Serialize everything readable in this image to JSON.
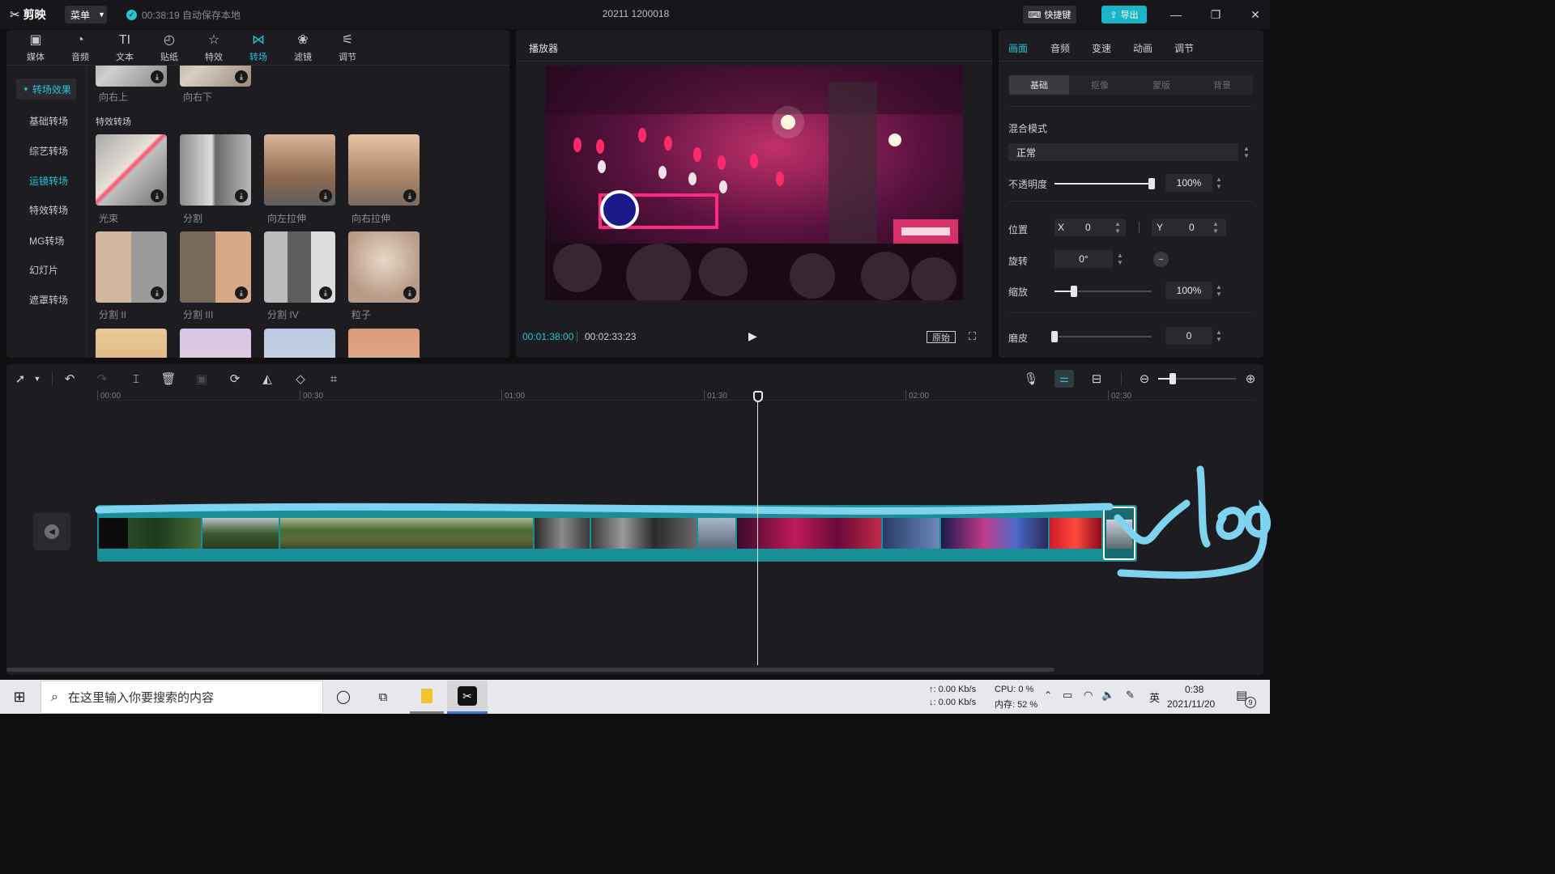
{
  "app": {
    "name": "剪映",
    "menu_label": "菜单",
    "save_status": "00:38:19 自动保存本地",
    "project_title": "20211 1200018",
    "shortcut_label": "快捷键",
    "export_label": "导出"
  },
  "media_tabs": [
    {
      "label": "媒体",
      "icon": "media-icon"
    },
    {
      "label": "音频",
      "icon": "audio-icon"
    },
    {
      "label": "文本",
      "icon": "text-icon"
    },
    {
      "label": "贴纸",
      "icon": "sticker-icon"
    },
    {
      "label": "特效",
      "icon": "effects-icon"
    },
    {
      "label": "转场",
      "icon": "transition-icon"
    },
    {
      "label": "滤镜",
      "icon": "filter-icon"
    },
    {
      "label": "调节",
      "icon": "adjust-icon"
    }
  ],
  "sidebar": {
    "header": "转场效果",
    "items": [
      "基础转场",
      "综艺转场",
      "运镜转场",
      "特效转场",
      "MG转场",
      "幻灯片",
      "遮罩转场"
    ]
  },
  "transitions": {
    "top_row": [
      "向右上",
      "向右下"
    ],
    "section_title": "特效转场",
    "row1": [
      "光束",
      "分割",
      "向左拉伸",
      "向右拉伸"
    ],
    "row2": [
      "分割 II",
      "分割 III",
      "分割 IV",
      "粒子"
    ]
  },
  "player": {
    "title": "播放器",
    "current_time": "00:01:38:00",
    "total_time": "00:02:33:23",
    "ratio_label": "原始"
  },
  "properties": {
    "tabs": [
      "画面",
      "音频",
      "变速",
      "动画",
      "调节"
    ],
    "subtabs": [
      "基础",
      "抠像",
      "蒙版",
      "背景"
    ],
    "blend_mode_label": "混合模式",
    "blend_mode_value": "正常",
    "opacity_label": "不透明度",
    "opacity_value": "100%",
    "opacity_level": 1.0,
    "position_label": "位置",
    "x_label": "X",
    "x_value": "0",
    "y_label": "Y",
    "y_value": "0",
    "rotation_label": "旋转",
    "rotation_value": "0°",
    "scale_label": "缩放",
    "scale_value": "100%",
    "scale_level": 0.2,
    "smooth_label": "磨皮",
    "smooth_value": "0",
    "smooth_level": 0.0
  },
  "timeline": {
    "ruler": [
      "00:00",
      "00:30",
      "01:00",
      "01:30",
      "02:00",
      "02:30"
    ],
    "handwritten_text": "vlog"
  },
  "taskbar": {
    "search_placeholder": "在这里输入你要搜索的内容",
    "net_up": "↑: 0.00 Kb/s",
    "net_down": "↓: 0.00 Kb/s",
    "cpu": "CPU: 0 %",
    "memory": "内存: 52 %",
    "ime": "英",
    "time": "0:38",
    "date": "2021/11/20",
    "notification_count": "9"
  },
  "colors": {
    "accent": "#27c3d6",
    "track": "#1a8e96",
    "scribble": "#7fd3ee"
  }
}
